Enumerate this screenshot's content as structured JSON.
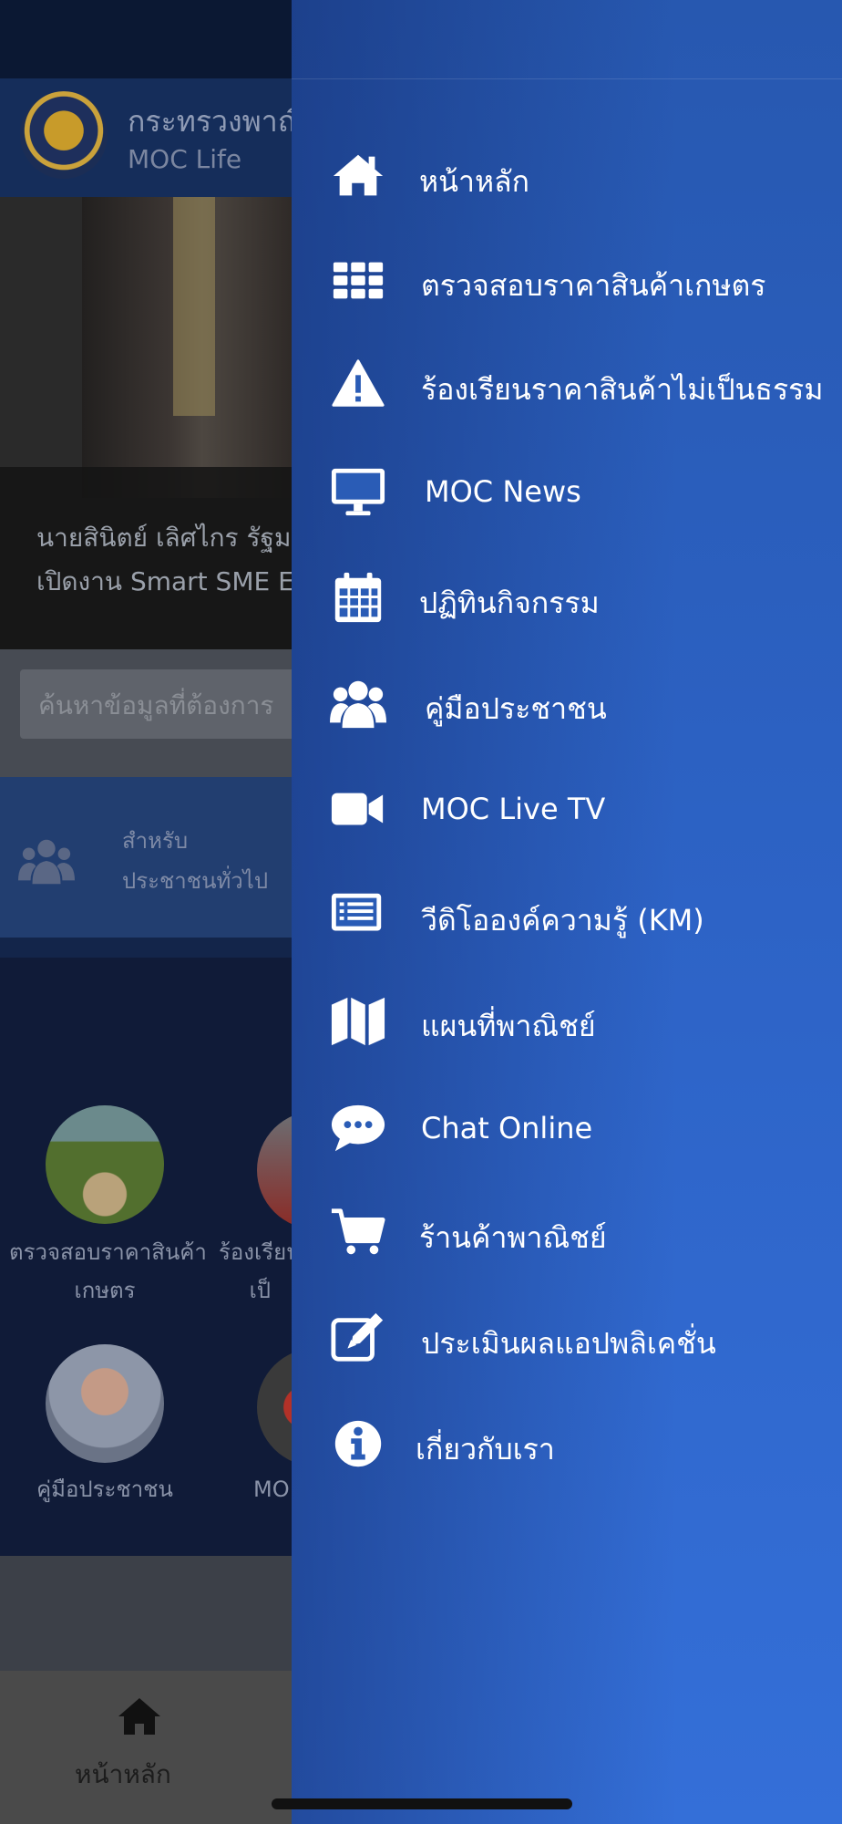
{
  "background_app": {
    "header_title": "กระทรวงพาณิ",
    "header_subtitle": "MOC Life",
    "hero_caption_line1": "นายสินิตย์ เลิศไกร รัฐมนต",
    "hero_caption_line2": "เปิดงาน Smart SME EX",
    "search_placeholder": "ค้นหาข้อมูลที่ต้องการ",
    "people_line1": "สำหรับ",
    "people_line2": "ประชาชนทั่วไป",
    "services": [
      {
        "label_line1": "ตรวจสอบราคาสินค้า",
        "label_line2": "เกษตร"
      },
      {
        "label_line1": "ร้องเรียน",
        "label_line2": "เป็"
      },
      {
        "label_line1": "คู่มือประชาชน",
        "label_line2": ""
      },
      {
        "label_line1": "MO",
        "label_line2": ""
      }
    ],
    "tab_home_label": "หน้าหลัก"
  },
  "drawer": {
    "items": [
      {
        "label": "หน้าหลัก",
        "icon": "home-icon"
      },
      {
        "label": "ตรวจสอบราคาสินค้าเกษตร",
        "icon": "grid-icon"
      },
      {
        "label": "ร้องเรียนราคาสินค้าไม่เป็นธรรม",
        "icon": "warning-icon"
      },
      {
        "label": "MOC News",
        "icon": "monitor-icon"
      },
      {
        "label": "ปฏิทินกิจกรรม",
        "icon": "calendar-icon"
      },
      {
        "label": "คู่มือประชาชน",
        "icon": "users-icon"
      },
      {
        "label": "MOC Live TV",
        "icon": "video-camera-icon"
      },
      {
        "label": "วีดิโอองค์ความรู้ (KM)",
        "icon": "list-icon"
      },
      {
        "label": "แผนที่พาณิชย์",
        "icon": "map-icon"
      },
      {
        "label": "Chat Online",
        "icon": "chat-bubble-icon"
      },
      {
        "label": "ร้านค้าพาณิชย์",
        "icon": "shopping-cart-icon"
      },
      {
        "label": "ประเมินผลแอปพลิเคชั่น",
        "icon": "edit-icon"
      },
      {
        "label": "เกี่ยวกับเรา",
        "icon": "info-icon"
      }
    ]
  },
  "colors": {
    "drawer_top": "#2758b0",
    "drawer_bottom": "#346fd8",
    "text": "#ffffff"
  }
}
